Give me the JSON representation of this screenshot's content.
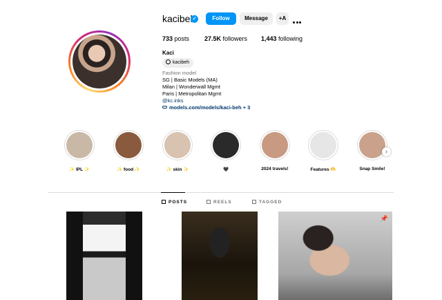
{
  "profile": {
    "username": "kacibeh",
    "follow_label": "Follow",
    "message_label": "Message",
    "suggest_icon": "add-person-icon",
    "stats": {
      "posts": "733",
      "posts_label": "posts",
      "followers": "27.5K",
      "followers_label": "followers",
      "following": "1,443",
      "following_label": "following"
    },
    "full_name": "Kaci",
    "threads_handle": "kacibeh",
    "category": "Fashion model",
    "bio_lines": [
      "SG | Basic Models (MA)",
      "Milan | Wonderwall Mgmt",
      "Paris | Metropolitan Mgmt"
    ],
    "mention": "@kc.inks",
    "link": "models.com/models/kaci-beh + 3"
  },
  "highlights": [
    {
      "label": "✨ IPL ✨",
      "color": "#c9b8a6"
    },
    {
      "label": "✨ food ✨",
      "color": "#8a5a3e"
    },
    {
      "label": "✨ skin ✨",
      "color": "#d8c2b0"
    },
    {
      "label": "🖤",
      "color": "#2a2a2a"
    },
    {
      "label": "2024 travels!",
      "color": "#c99a82"
    },
    {
      "label": "Features 🫶",
      "color": "#e6e6e6"
    },
    {
      "label": "Snap Smile!",
      "color": "#caa28c"
    }
  ],
  "tabs": {
    "posts": "POSTS",
    "reels": "REELS",
    "tagged": "TAGGED"
  },
  "colors": {
    "accent": "#0095f6",
    "link": "#00376b",
    "muted": "#737373"
  }
}
